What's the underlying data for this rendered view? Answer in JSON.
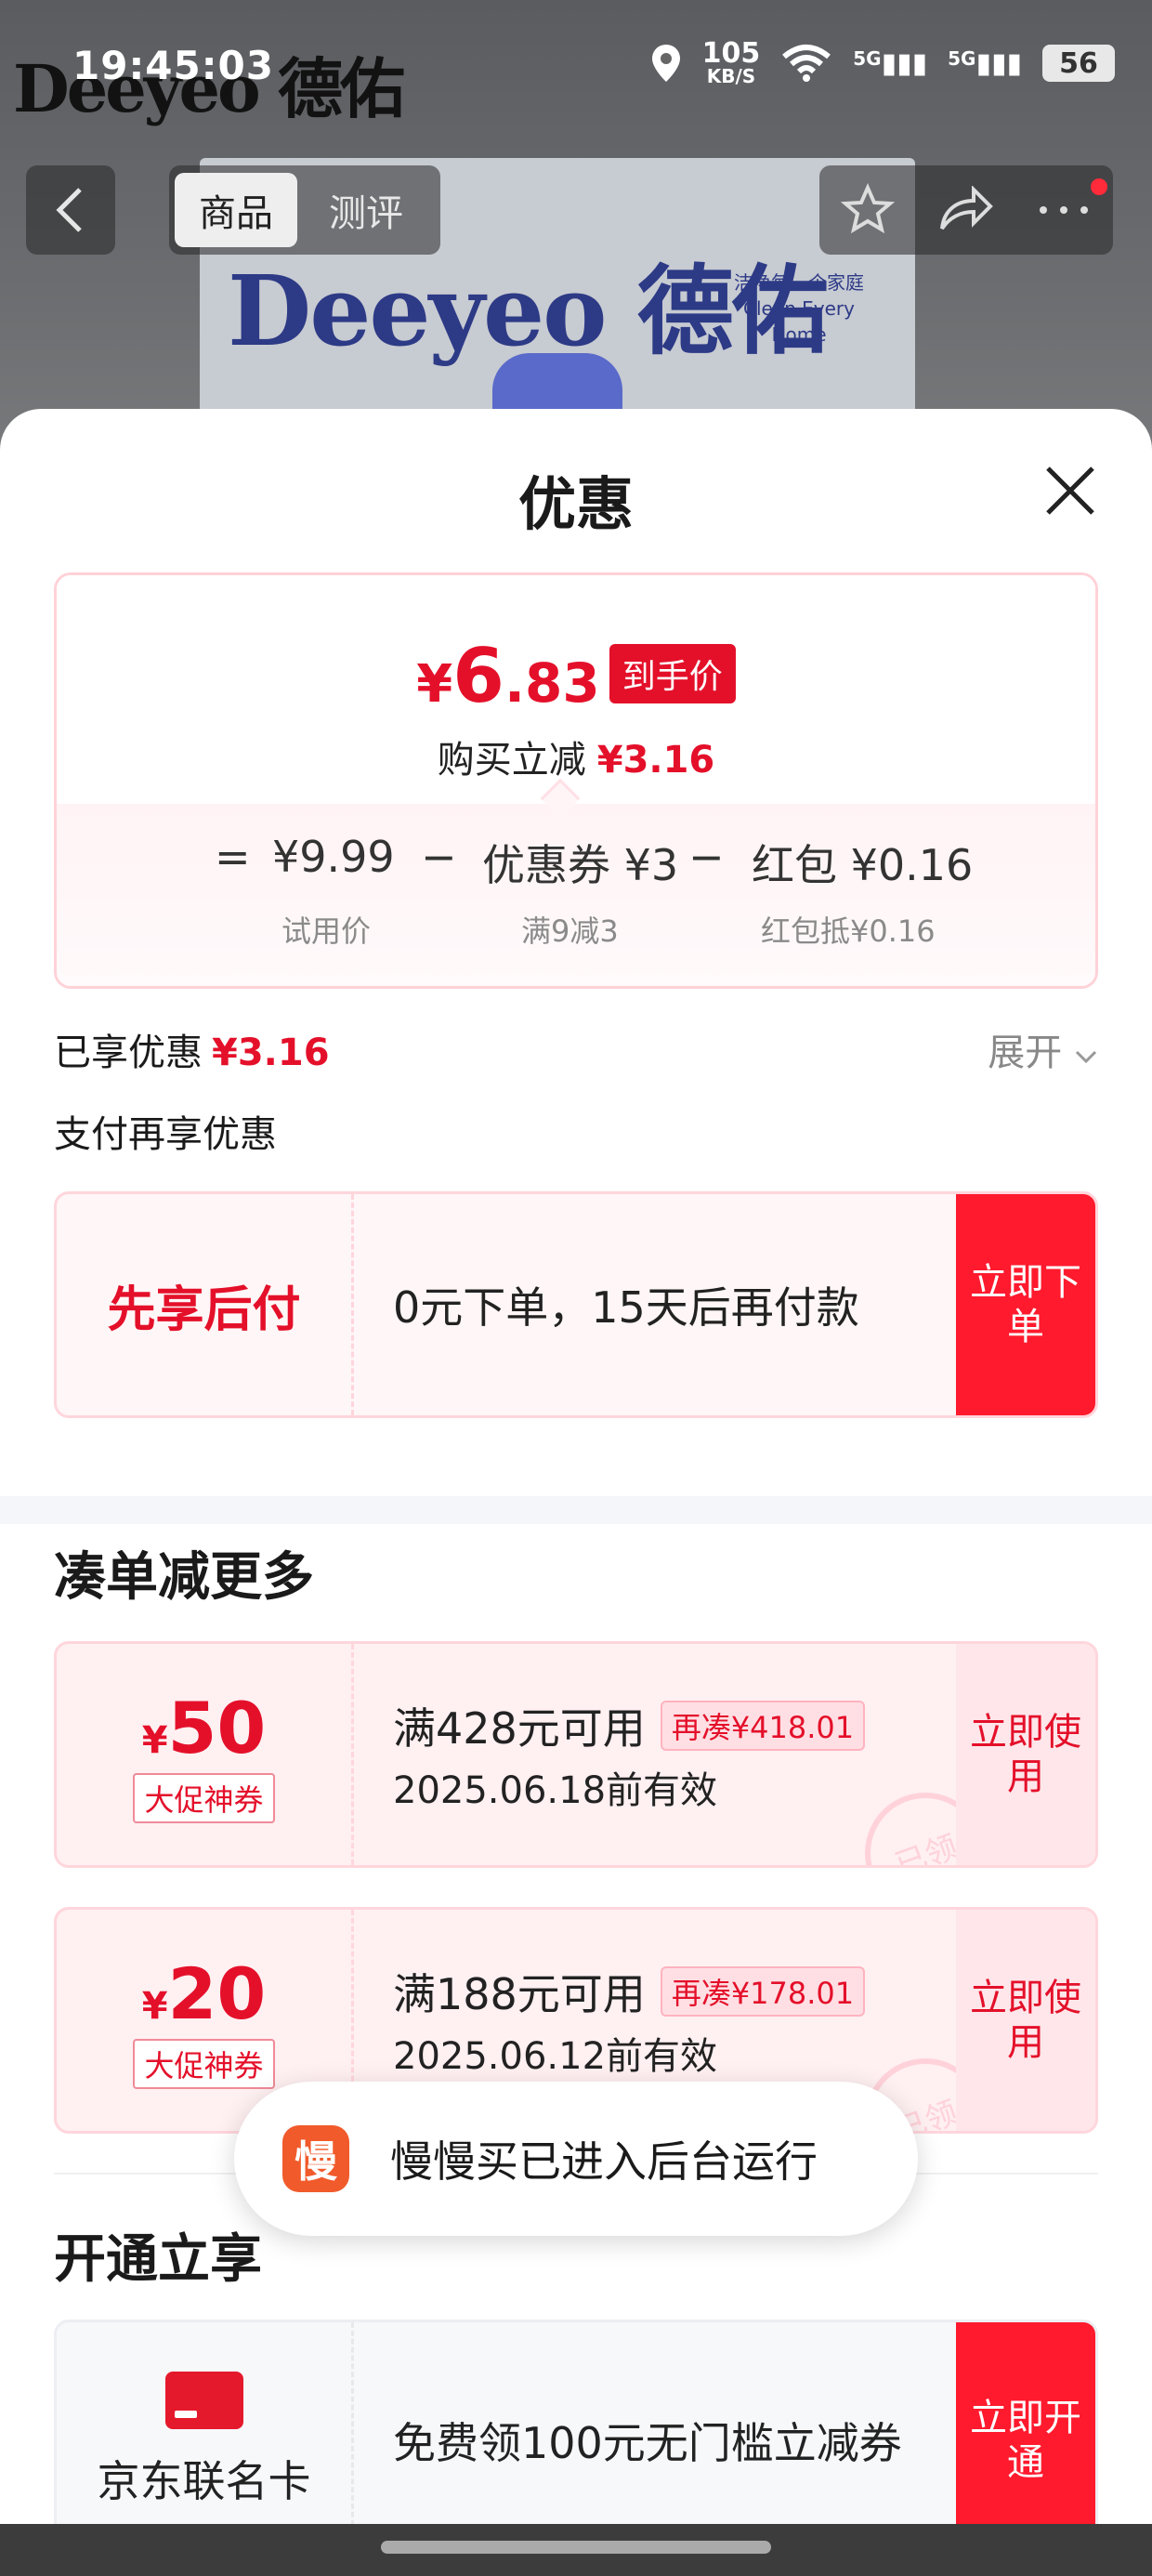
{
  "status_bar": {
    "time": "19:45:03",
    "net_speed_value": "105",
    "net_speed_unit": "KB/S",
    "signal_1": "5G",
    "signal_2": "5G",
    "battery": "56"
  },
  "background": {
    "brand_logo": "Deeyeo 德佑",
    "slogan_cn": "洁净每一个家庭",
    "slogan_en": "Clean Every Home"
  },
  "nav": {
    "back_icon": "chevron-left-icon",
    "tabs": [
      {
        "label": "商品",
        "active": true
      },
      {
        "label": "测评",
        "active": false
      }
    ],
    "actions": [
      "star-icon",
      "share-icon",
      "more-icon"
    ]
  },
  "sheet": {
    "title": "优惠",
    "close_icon": "close-icon"
  },
  "price_summary": {
    "currency": "¥",
    "price_int": "6",
    "price_dec": ".83",
    "tag": "到手价",
    "reduce_label": "购买立减",
    "reduce_value": "¥3.16",
    "equals": "=",
    "items": [
      {
        "value": "¥9.99",
        "label": "试用价"
      },
      {
        "op": "−",
        "value": "优惠券 ¥3",
        "label": "满9减3"
      },
      {
        "op": "−",
        "value": "红包 ¥0.16",
        "label": "红包抵¥0.16"
      }
    ]
  },
  "enjoyed": {
    "label": "已享优惠",
    "value": "¥3.16",
    "expand": "展开"
  },
  "pay_more": {
    "title": "支付再享优惠",
    "bnpl_label": "先享后付",
    "bnpl_text": "0元下单，15天后再付款",
    "button": "立即下单"
  },
  "coupons_section": {
    "title": "凑单减更多",
    "coupons": [
      {
        "currency": "¥",
        "amount": "50",
        "badge": "大促神券",
        "condition": "满428元可用",
        "need": "再凑¥418.01",
        "valid": "2025.06.18前有效",
        "button": "立即使用",
        "stamp": "已领"
      },
      {
        "currency": "¥",
        "amount": "20",
        "badge": "大促神券",
        "condition": "满188元可用",
        "need": "再凑¥178.01",
        "valid": "2025.06.12前有效",
        "button": "立即使用",
        "stamp": "已领"
      }
    ]
  },
  "toast": {
    "icon_char": "慢",
    "text": "慢慢买已进入后台运行"
  },
  "open_section": {
    "title": "开通立享",
    "card_label": "京东联名卡",
    "text": "免费领100元无门槛立减券",
    "button": "立即开通"
  },
  "colors": {
    "accent": "#e4102a",
    "button_red": "#ff1a2e",
    "card_border": "#ffd6dc"
  }
}
